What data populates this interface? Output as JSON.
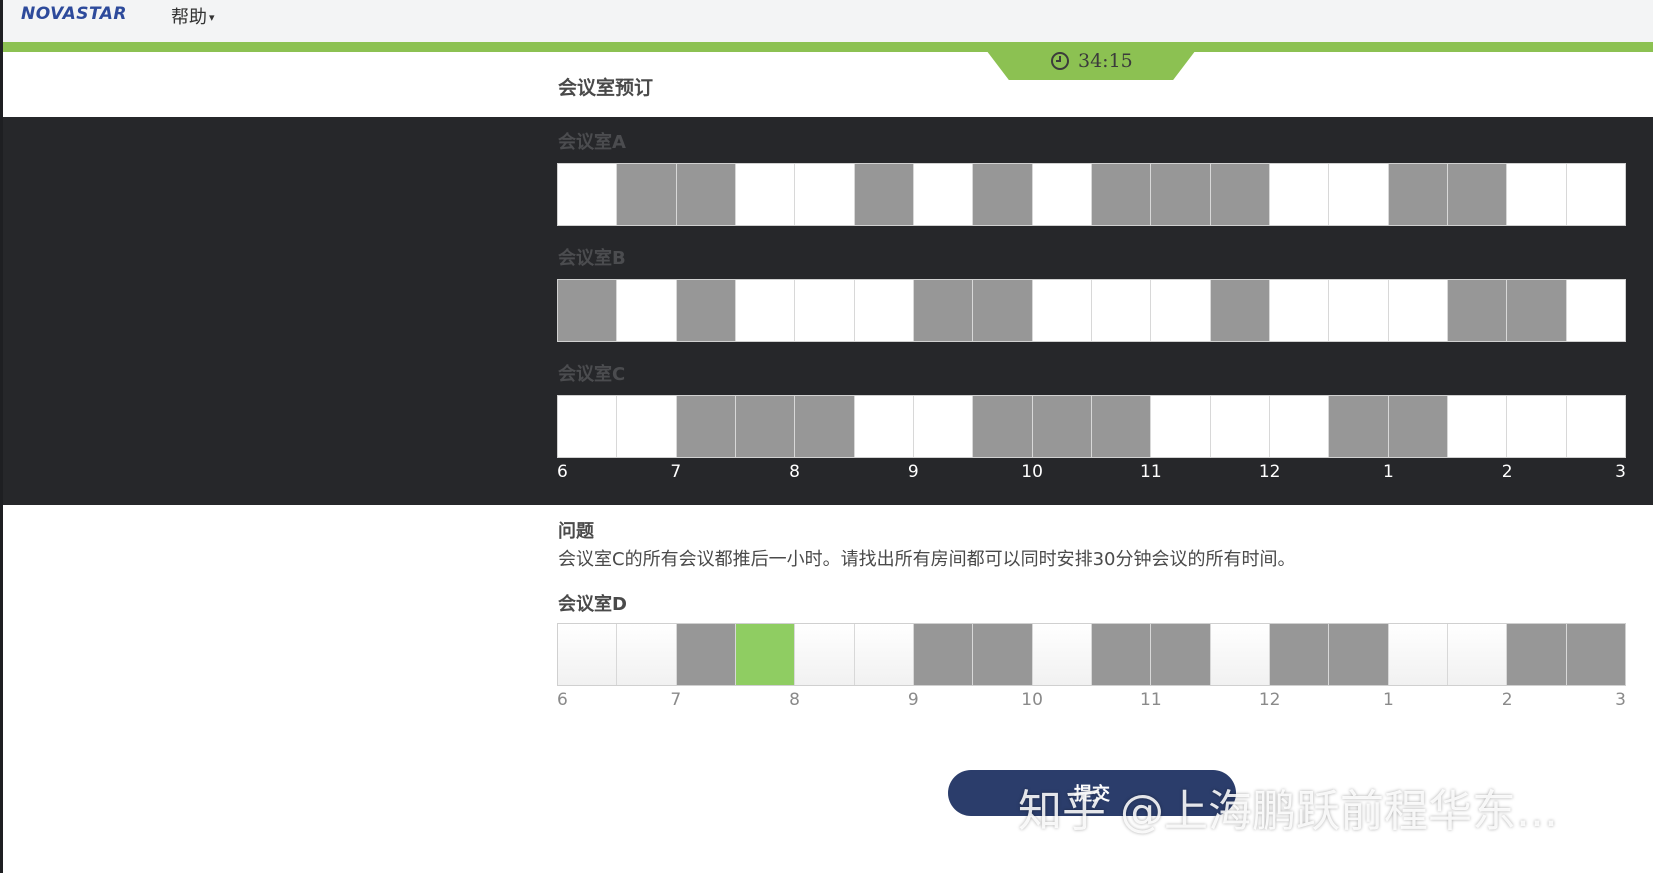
{
  "header": {
    "logo_text": "NOVASTAR",
    "help_label": "帮助",
    "timer": "34:15",
    "accent_color": "#8cc152"
  },
  "page": {
    "title": "会议室预订"
  },
  "time_axis": [
    "6",
    "7",
    "8",
    "9",
    "10",
    "11",
    "12",
    "1",
    "2",
    "3"
  ],
  "rooms": [
    {
      "label": "会议室A",
      "busy": [
        0,
        1,
        1,
        0,
        0,
        1,
        0,
        1,
        0,
        1,
        1,
        1,
        0,
        0,
        1,
        1,
        0,
        0
      ]
    },
    {
      "label": "会议室B",
      "busy": [
        1,
        0,
        1,
        0,
        0,
        0,
        1,
        1,
        0,
        0,
        0,
        1,
        0,
        0,
        0,
        1,
        1,
        0
      ]
    },
    {
      "label": "会议室C",
      "busy": [
        0,
        0,
        1,
        1,
        1,
        0,
        0,
        1,
        1,
        1,
        0,
        0,
        0,
        1,
        1,
        0,
        0,
        0
      ]
    }
  ],
  "question": {
    "title": "问题",
    "text": "会议室C的所有会议都推后一小时。请找出所有房间都可以同时安排30分钟会议的所有时间。"
  },
  "room_d": {
    "label": "会议室D",
    "states": [
      "free",
      "free",
      "busy",
      "booked",
      "free",
      "free",
      "busy",
      "busy",
      "free",
      "busy",
      "busy",
      "free",
      "busy",
      "busy",
      "free",
      "free",
      "busy",
      "busy"
    ]
  },
  "submit": {
    "label": "提交"
  },
  "watermark": "知乎 @上海鹏跃前程华东..."
}
